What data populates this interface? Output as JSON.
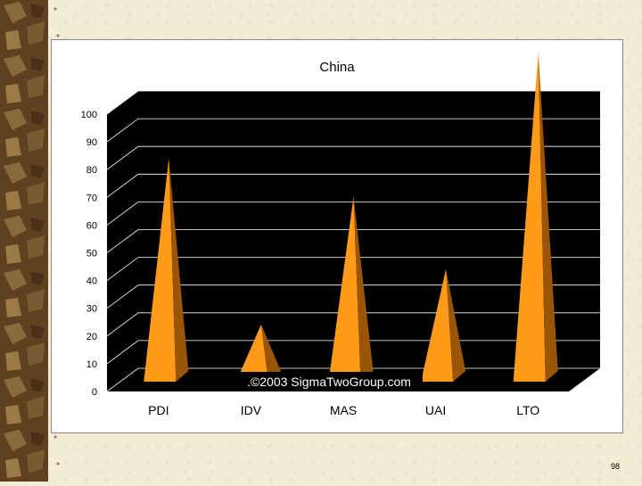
{
  "slide": {
    "page_number": "98",
    "watermark": ".©2003 SigmaTwoGroup.com"
  },
  "colors": {
    "background": "#f3ecd6",
    "plot_back": "#000000",
    "bar_light": "#ff9b19",
    "bar_dark": "#9a5606"
  },
  "chart_data": {
    "type": "bar",
    "style": "3d-pyramid",
    "title": "China",
    "categories": [
      "PDI",
      "IDV",
      "MAS",
      "UAI",
      "LTO"
    ],
    "values": [
      80,
      20,
      66,
      40,
      118
    ],
    "ylim": [
      0,
      100
    ],
    "yticks": [
      "0",
      "10",
      "20",
      "30",
      "40",
      "50",
      "60",
      "70",
      "80",
      "90",
      "100"
    ],
    "grid": true
  }
}
